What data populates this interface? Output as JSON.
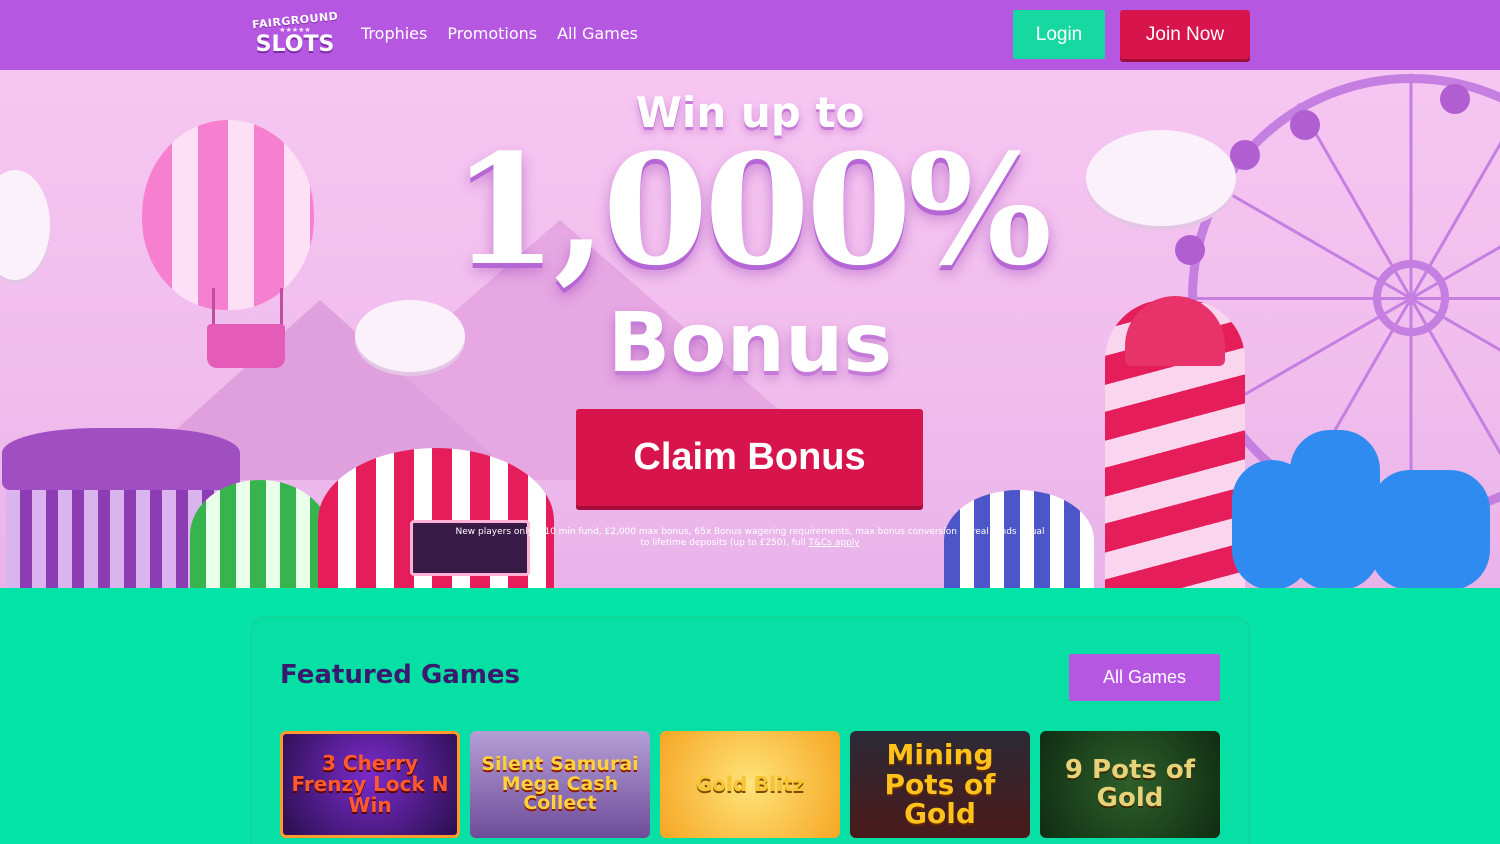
{
  "header": {
    "logo_small": "FAIRGROUND",
    "logo_stars": "★★★★★",
    "logo_big": "SLOTS",
    "nav": [
      "Trophies",
      "Promotions",
      "All Games"
    ],
    "login_label": "Login",
    "join_label": "Join Now"
  },
  "hero": {
    "headline_top": "Win up to",
    "headline_percent": "1,000%",
    "headline_bonus": "Bonus",
    "cta_label": "Claim Bonus",
    "terms_text": "New players only, £10 min fund, £2,000 max bonus, 65x Bonus wagering requirements, max bonus conversion to real funds equal to lifetime deposits (up to £250), full",
    "terms_link": "T&Cs apply"
  },
  "featured": {
    "title": "Featured Games",
    "all_games_label": "All Games",
    "games": [
      "3 Cherry Frenzy Lock N Win",
      "Silent Samurai Mega Cash Collect",
      "Gold Blitz",
      "Mining Pots of Gold",
      "9 Pots of Gold"
    ]
  },
  "colors": {
    "header_bg": "#b557e0",
    "login_bg": "#16d8a0",
    "cta_red": "#d8144d",
    "page_green": "#05e3a6",
    "title_dark": "#3a1a6e"
  }
}
